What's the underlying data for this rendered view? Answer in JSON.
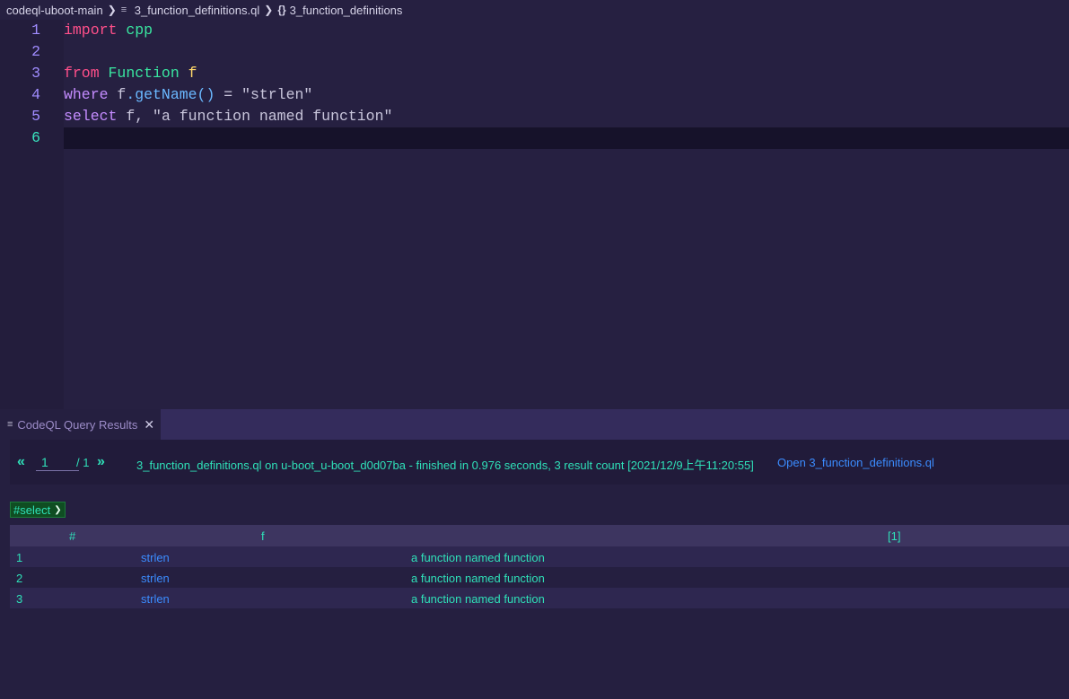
{
  "breadcrumb": {
    "folder": "codeql-uboot-main",
    "file": "3_function_definitions.ql",
    "symbol": "3_function_definitions"
  },
  "editor": {
    "lines": [
      {
        "n": "1"
      },
      {
        "n": "2"
      },
      {
        "n": "3"
      },
      {
        "n": "4"
      },
      {
        "n": "5"
      },
      {
        "n": "6"
      }
    ],
    "tokens": {
      "import": "import",
      "cpp": "cpp",
      "from": "from",
      "Function": "Function",
      "f3": "f",
      "where": "where",
      "f4": "f",
      "getName": ".getName()",
      "eq": " = ",
      "strlen_str": "\"strlen\"",
      "select": "select",
      "f5": "f,",
      "msg": "\"a function named function\""
    }
  },
  "panel": {
    "tab_title": "CodeQL Query Results",
    "pager": {
      "prev": "«",
      "next": "»",
      "page": "1",
      "total": "/ 1"
    },
    "status": "3_function_definitions.ql on u-boot_u-boot_d0d07ba - finished in 0.976 seconds, 3 result count [2021/12/9上午11:20:55]",
    "open_link": "Open 3_function_definitions.ql",
    "select_value": "#select",
    "table": {
      "headers": [
        "#",
        "f",
        "[1]"
      ],
      "rows": [
        {
          "num": "1",
          "f": "strlen",
          "msg": "a function named function"
        },
        {
          "num": "2",
          "f": "strlen",
          "msg": "a function named function"
        },
        {
          "num": "3",
          "f": "strlen",
          "msg": "a function named function"
        }
      ]
    }
  }
}
